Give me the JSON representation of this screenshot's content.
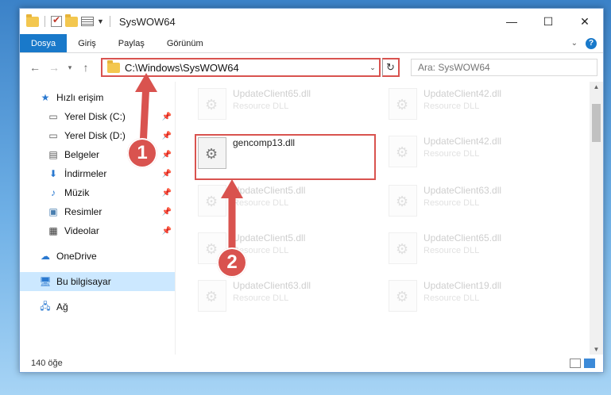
{
  "window": {
    "title": "SysWOW64",
    "controls": {
      "minimize": "—",
      "maximize": "☐",
      "close": "✕"
    }
  },
  "ribbon": {
    "tabs": [
      "Dosya",
      "Giriş",
      "Paylaş",
      "Görünüm"
    ],
    "help": "?"
  },
  "nav": {
    "back": "←",
    "forward": "→",
    "recent": "▾",
    "up": "↑",
    "address": "C:\\Windows\\SysWOW64",
    "refresh": "↻",
    "search_placeholder": "Ara: SysWOW64"
  },
  "sidebar": {
    "items": [
      {
        "label": "Hızlı erişim",
        "icon": "star-icon",
        "level": 0,
        "pinned": false
      },
      {
        "label": "Yerel Disk (C:)",
        "icon": "drive-icon",
        "level": 1,
        "pinned": true
      },
      {
        "label": "Yerel Disk (D:)",
        "icon": "drive-icon",
        "level": 1,
        "pinned": true
      },
      {
        "label": "Belgeler",
        "icon": "documents-icon",
        "level": 1,
        "pinned": true
      },
      {
        "label": "İndirmeler",
        "icon": "download-icon",
        "level": 1,
        "pinned": true
      },
      {
        "label": "Müzik",
        "icon": "music-icon",
        "level": 1,
        "pinned": true
      },
      {
        "label": "Resimler",
        "icon": "pictures-icon",
        "level": 1,
        "pinned": true
      },
      {
        "label": "Videolar",
        "icon": "videos-icon",
        "level": 1,
        "pinned": true
      },
      {
        "label": "OneDrive",
        "icon": "cloud-icon",
        "level": 0,
        "pinned": false
      },
      {
        "label": "Bu bilgisayar",
        "icon": "computer-icon",
        "level": 0,
        "pinned": false,
        "selected": true
      },
      {
        "label": "Ağ",
        "icon": "network-icon",
        "level": 0,
        "pinned": false
      }
    ]
  },
  "files": [
    {
      "name": "UpdateClient65.dll",
      "type": "Resource DLL"
    },
    {
      "name": "UpdateClient42.dll",
      "type": "Resource DLL"
    },
    {
      "name": "gencomp13.dll",
      "type": "",
      "focus": true
    },
    {
      "name": "UpdateClient42.dll",
      "type": "Resource DLL"
    },
    {
      "name": "UpdateClient5.dll",
      "type": "Resource DLL"
    },
    {
      "name": "UpdateClient63.dll",
      "type": "Resource DLL"
    },
    {
      "name": "UpdateClient5.dll",
      "type": "Resource DLL"
    },
    {
      "name": "UpdateClient65.dll",
      "type": "Resource DLL"
    },
    {
      "name": "UpdateClient63.dll",
      "type": "Resource DLL"
    },
    {
      "name": "UpdateClient19.dll",
      "type": "Resource DLL"
    }
  ],
  "status": {
    "count": "140 öğe"
  },
  "annotations": {
    "step1": "1",
    "step2": "2",
    "color": "#d9534f"
  }
}
